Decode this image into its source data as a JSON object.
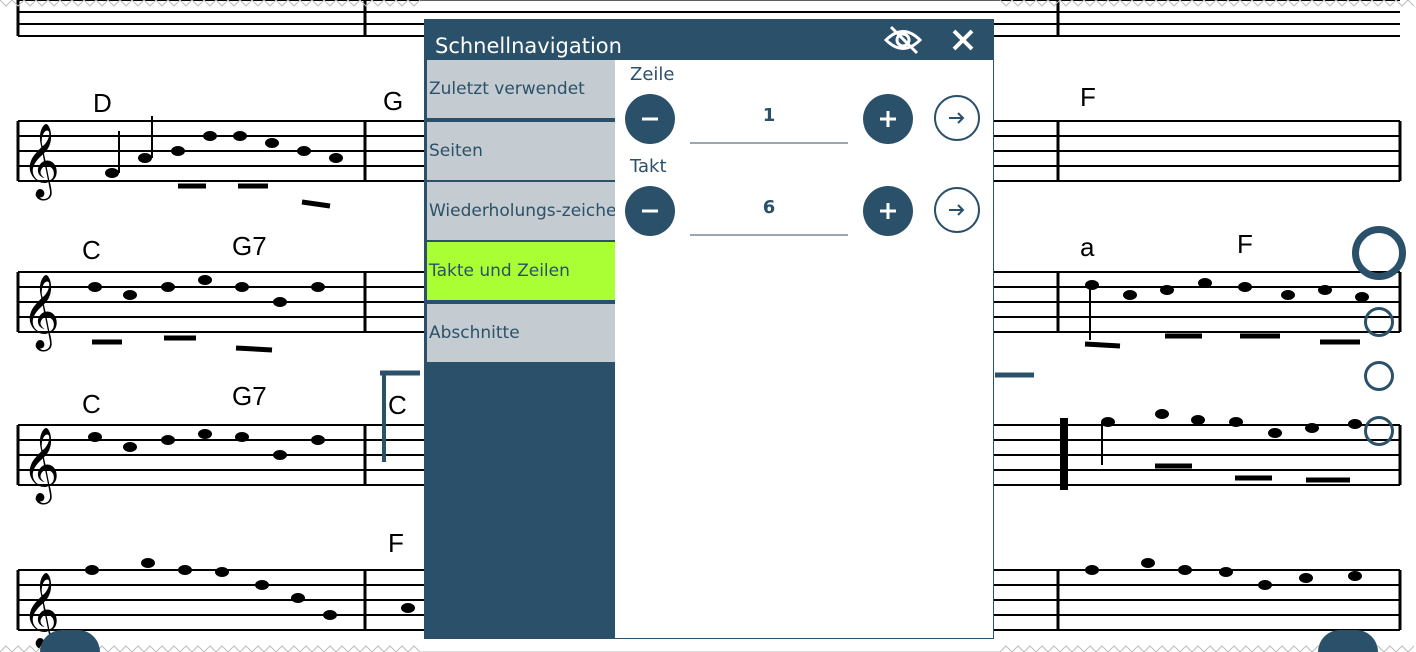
{
  "panel": {
    "title": "Schnellnavigation",
    "hide_icon": "eye-off-icon",
    "close_icon": "close-icon"
  },
  "sidebar": {
    "items": [
      {
        "label": "Zuletzt verwendet",
        "active": false
      },
      {
        "label": "Seiten",
        "active": false
      },
      {
        "label": "Wiederholungs-zeichen",
        "active": false
      },
      {
        "label": "Takte und Zeilen",
        "active": true
      },
      {
        "label": "Abschnitte",
        "active": false
      }
    ]
  },
  "content": {
    "row": {
      "label": "Zeile",
      "value": "1"
    },
    "measure": {
      "label": "Takt",
      "value": "6"
    }
  },
  "score": {
    "chords": [
      "D",
      "G",
      "F",
      "C",
      "G7",
      "a",
      "F",
      "C",
      "G7",
      "C",
      "F"
    ]
  },
  "colors": {
    "primary": "#2b5069",
    "sidebar_item": "#c4ccd1",
    "active_item": "#a9ff33"
  }
}
